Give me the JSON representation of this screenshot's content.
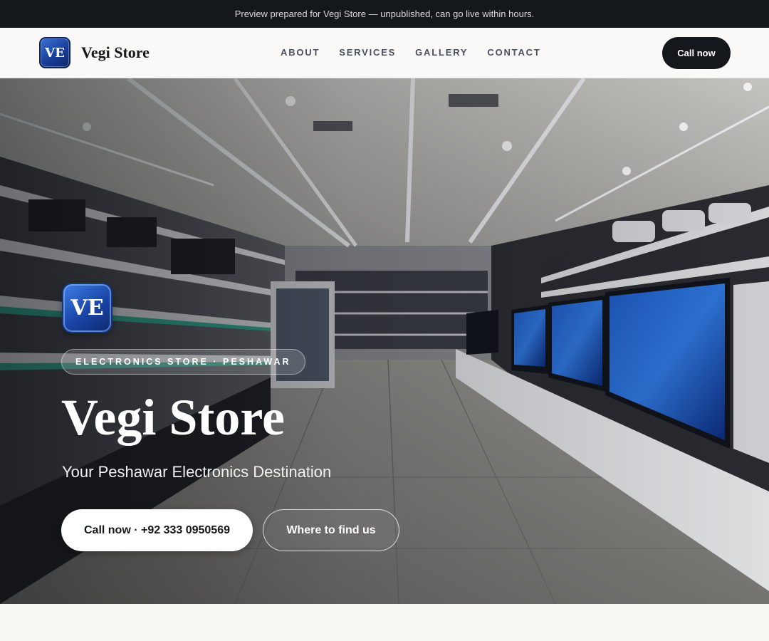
{
  "announcement": {
    "text": "Preview prepared for Vegi Store — unpublished, can go live within hours."
  },
  "header": {
    "logo_text": "VE",
    "brand_name": "Vegi Store",
    "nav": [
      "ABOUT",
      "SERVICES",
      "GALLERY",
      "CONTACT"
    ],
    "cta_label": "Call now"
  },
  "hero": {
    "logo_text": "VE",
    "eyebrow": "ELECTRONICS STORE · PESHAWAR",
    "title": "Vegi Store",
    "subtitle": "Your Peshawar Electronics Destination",
    "primary_button": "Call now · +92 333 0950569",
    "secondary_button": "Where to find us"
  },
  "colors": {
    "announcement_bg": "#14171c",
    "accent_dark": "#14171c",
    "logo_blue": "#1a44a6",
    "page_bg": "#f9f8f5"
  }
}
